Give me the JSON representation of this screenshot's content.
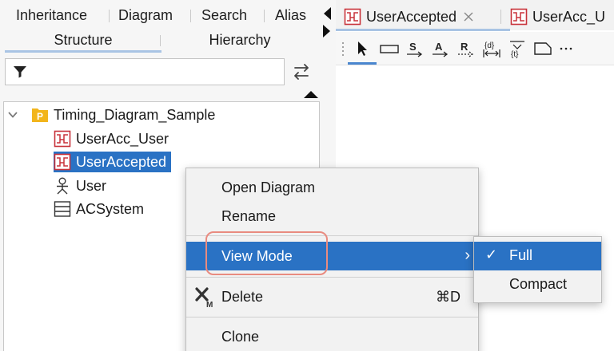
{
  "top_tabs": [
    "Inheritance",
    "Diagram",
    "Search",
    "Alias"
  ],
  "sub_tabs": [
    "Structure",
    "Hierarchy"
  ],
  "filter": {
    "placeholder": ""
  },
  "tree": {
    "root": "Timing_Diagram_Sample",
    "children": [
      "UserAcc_User",
      "UserAccepted",
      "User",
      "ACSystem"
    ],
    "selected": "UserAccepted"
  },
  "editor_tabs": [
    "UserAccepted",
    "UserAcc_U"
  ],
  "context_menu": {
    "items": {
      "open_diagram": "Open Diagram",
      "rename": "Rename",
      "view_mode": "View Mode",
      "delete": "Delete",
      "delete_shortcut": "⌘D",
      "clone": "Clone"
    },
    "view_mode_arrow": "›"
  },
  "submenu": {
    "full": "Full",
    "compact": "Compact",
    "selected_mark": "✓"
  },
  "colors": {
    "selection": "#2a72c4",
    "highlight_outline": "#e98b80",
    "diagram_icon": "#c8323a",
    "package_icon": "#f2b51c"
  }
}
